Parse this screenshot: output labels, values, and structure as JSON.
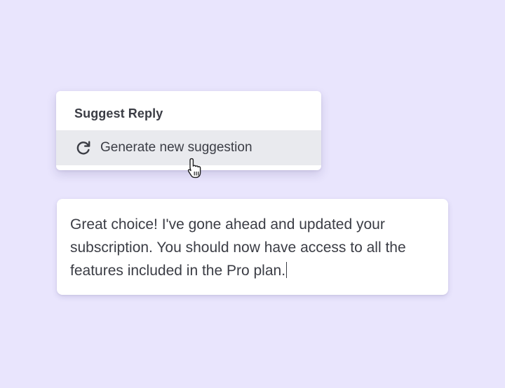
{
  "menu": {
    "title": "Suggest Reply",
    "items": [
      {
        "label": "Generate new suggestion",
        "icon": "refresh-icon"
      }
    ]
  },
  "reply": {
    "text": "Great choice! I've gone ahead and updated your subscription. You should now have access to all the features included in the Pro plan."
  },
  "colors": {
    "background": "#e9e5fd",
    "card": "#ffffff",
    "hover": "#e9eaee",
    "text": "#3b3d45"
  }
}
